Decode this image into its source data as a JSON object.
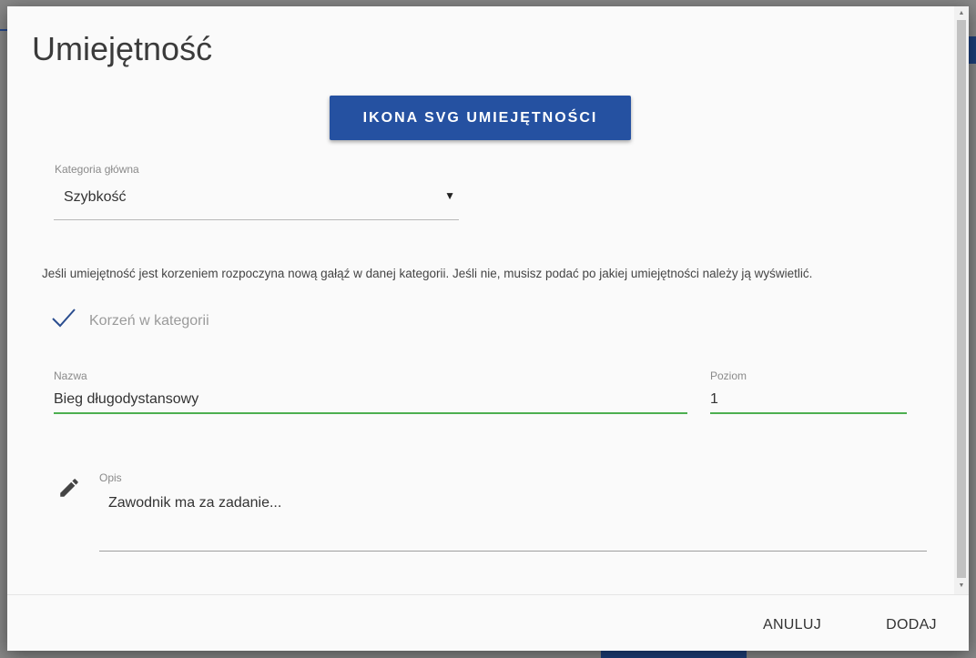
{
  "dialog": {
    "title": "Umiejętność",
    "svg_button_label": "IKONA SVG UMIEJĘTNOŚCI",
    "category": {
      "label": "Kategoria główna",
      "value": "Szybkość"
    },
    "help_text": "Jeśli umiejętność jest korzeniem rozpoczyna nową gałąź w danej kategorii. Jeśli nie, musisz podać po jakiej umiejętności należy ją wyświetlić.",
    "root_checkbox": {
      "label": "Korzeń w kategorii",
      "checked": true
    },
    "name": {
      "label": "Nazwa",
      "value": "Bieg długodystansowy"
    },
    "level": {
      "label": "Poziom",
      "value": "1"
    },
    "description": {
      "label": "Opis",
      "value": "Zawodnik ma za zadanie..."
    },
    "footer": {
      "cancel_label": "ANULUJ",
      "add_label": "DODAJ"
    }
  },
  "colors": {
    "primary": "#2551a1",
    "field_focus": "#4caf50",
    "check": "#2a4d8f"
  },
  "icons": {
    "check": "check-icon",
    "pencil": "pencil-icon",
    "caret": "caret-down-icon"
  }
}
